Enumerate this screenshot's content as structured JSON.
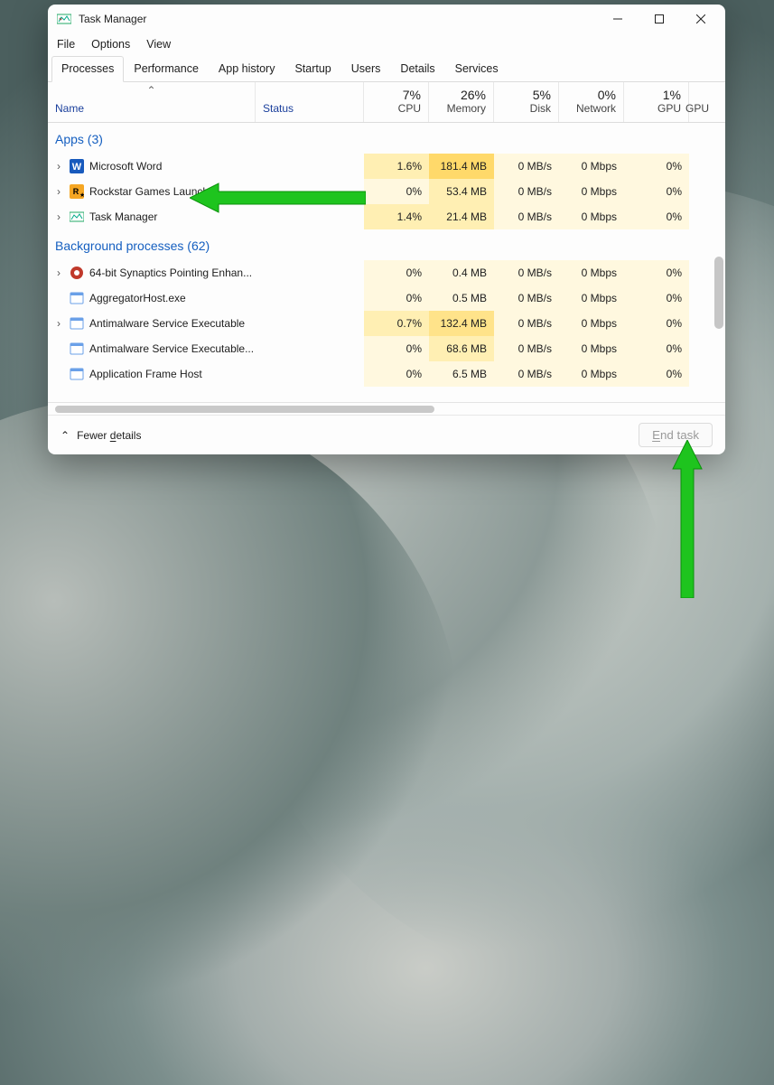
{
  "window": {
    "title": "Task Manager",
    "menus": [
      "File",
      "Options",
      "View"
    ],
    "tabs": [
      "Processes",
      "Performance",
      "App history",
      "Startup",
      "Users",
      "Details",
      "Services"
    ],
    "active_tab": 0
  },
  "columns": {
    "name": "Name",
    "status": "Status",
    "metrics": [
      {
        "pct": "7%",
        "label": "CPU"
      },
      {
        "pct": "26%",
        "label": "Memory"
      },
      {
        "pct": "5%",
        "label": "Disk"
      },
      {
        "pct": "0%",
        "label": "Network"
      },
      {
        "pct": "1%",
        "label": "GPU"
      },
      {
        "pct": "",
        "label": "GPU"
      }
    ]
  },
  "groups": {
    "apps": {
      "title": "Apps",
      "count": 3
    },
    "bg": {
      "title": "Background processes",
      "count": 62
    }
  },
  "apps": [
    {
      "name": "Microsoft Word",
      "expandable": true,
      "icon": "word",
      "cpu": "1.6%",
      "mem": "181.4 MB",
      "disk": "0 MB/s",
      "net": "0 Mbps",
      "gpu": "0%"
    },
    {
      "name": "Rockstar Games Launcher",
      "expandable": true,
      "icon": "rockstar",
      "cpu": "0%",
      "mem": "53.4 MB",
      "disk": "0 MB/s",
      "net": "0 Mbps",
      "gpu": "0%"
    },
    {
      "name": "Task Manager",
      "expandable": true,
      "icon": "taskmgr",
      "cpu": "1.4%",
      "mem": "21.4 MB",
      "disk": "0 MB/s",
      "net": "0 Mbps",
      "gpu": "0%"
    }
  ],
  "bg": [
    {
      "name": "64-bit Synaptics Pointing Enhan...",
      "expandable": true,
      "icon": "synaptics",
      "cpu": "0%",
      "mem": "0.4 MB",
      "disk": "0 MB/s",
      "net": "0 Mbps",
      "gpu": "0%"
    },
    {
      "name": "AggregatorHost.exe",
      "expandable": false,
      "icon": "generic",
      "cpu": "0%",
      "mem": "0.5 MB",
      "disk": "0 MB/s",
      "net": "0 Mbps",
      "gpu": "0%"
    },
    {
      "name": "Antimalware Service Executable",
      "expandable": true,
      "icon": "generic",
      "cpu": "0.7%",
      "mem": "132.4 MB",
      "disk": "0 MB/s",
      "net": "0 Mbps",
      "gpu": "0%"
    },
    {
      "name": "Antimalware Service Executable...",
      "expandable": false,
      "icon": "generic",
      "cpu": "0%",
      "mem": "68.6 MB",
      "disk": "0 MB/s",
      "net": "0 Mbps",
      "gpu": "0%"
    },
    {
      "name": "Application Frame Host",
      "expandable": false,
      "icon": "generic",
      "cpu": "0%",
      "mem": "6.5 MB",
      "disk": "0 MB/s",
      "net": "0 Mbps",
      "gpu": "0%"
    }
  ],
  "footer": {
    "fewer_prefix": "Fewer ",
    "fewer_underlined": "d",
    "fewer_suffix": "etails",
    "end_prefix": "",
    "end_underlined": "E",
    "end_suffix": "nd task"
  },
  "heat": {
    "apps": [
      [
        "heat1",
        "heat3",
        "heat0",
        "heat0",
        "heat0"
      ],
      [
        "heat0",
        "heat1",
        "heat0",
        "heat0",
        "heat0"
      ],
      [
        "heat1",
        "heat1",
        "heat0",
        "heat0",
        "heat0"
      ]
    ],
    "bg": [
      [
        "heat0",
        "heat0",
        "heat0",
        "heat0",
        "heat0"
      ],
      [
        "heat0",
        "heat0",
        "heat0",
        "heat0",
        "heat0"
      ],
      [
        "heat1",
        "heat2",
        "heat0",
        "heat0",
        "heat0"
      ],
      [
        "heat0",
        "heat1",
        "heat0",
        "heat0",
        "heat0"
      ],
      [
        "heat0",
        "heat0",
        "heat0",
        "heat0",
        "heat0"
      ]
    ]
  }
}
